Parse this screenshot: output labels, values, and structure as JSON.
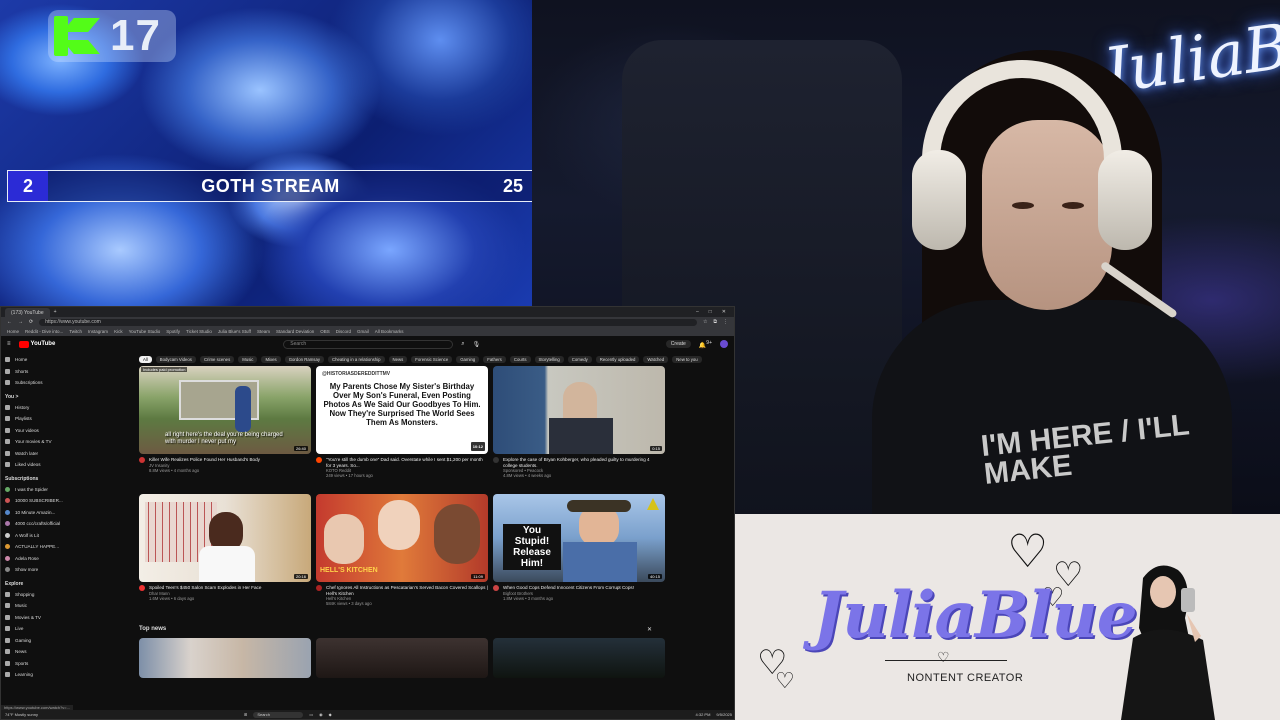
{
  "overlay": {
    "kick_viewers": "17",
    "goth_stream": {
      "left_value": "2",
      "title": "GOTH STREAM",
      "right_value": "25"
    }
  },
  "neon_sign": "JuliaB",
  "hoodie_text": "I'M HERE / I'LL MAKE",
  "brand": {
    "name": "JuliaBlue",
    "subtitle": "NONTENT CREATOR",
    "accent_color": "#7b74e8"
  },
  "browser": {
    "tab_title": "(173) YouTube",
    "url": "https://www.youtube.com",
    "bookmarks": [
      "Home",
      "Reddit - Dive into...",
      "Twitch",
      "Instagram",
      "Kick",
      "YouTube Studio",
      "Spotify",
      "Ticket Studio",
      "Julia Blue's Stuff",
      "Steam",
      "Standard Deviation",
      "OBS",
      "Discord",
      "Gmail",
      "All Bookmarks"
    ],
    "youtube": {
      "logo": "YouTube",
      "search_placeholder": "Search",
      "create_label": "Create",
      "notification_count": "9+",
      "sidebar": {
        "main": [
          {
            "label": "Home",
            "icon": "home-icon"
          },
          {
            "label": "Shorts",
            "icon": "shorts-icon"
          },
          {
            "label": "Subscriptions",
            "icon": "subscriptions-icon"
          }
        ],
        "you_header": "You  >",
        "you": [
          {
            "label": "History",
            "icon": "history-icon"
          },
          {
            "label": "Playlists",
            "icon": "playlist-icon"
          },
          {
            "label": "Your videos",
            "icon": "video-icon"
          },
          {
            "label": "Your movies & TV",
            "icon": "movie-icon"
          },
          {
            "label": "Watch later",
            "icon": "clock-icon"
          },
          {
            "label": "Liked videos",
            "icon": "like-icon"
          }
        ],
        "subscriptions_header": "Subscriptions",
        "subscriptions": [
          {
            "label": "I was the Spider",
            "color": "#6a6"
          },
          {
            "label": "10000 SUBSCRIBER...",
            "color": "#c55"
          },
          {
            "label": "10 Minute Amazin...",
            "color": "#58c"
          },
          {
            "label": "4000 ccc/crafts/official",
            "color": "#a7a"
          },
          {
            "label": "A Wolf is Lit",
            "color": "#ccc"
          },
          {
            "label": "ACTUALLY HAPPE...",
            "color": "#d93"
          },
          {
            "label": "Adela Rose",
            "color": "#c8a"
          },
          {
            "label": "Show more",
            "color": "#888"
          }
        ],
        "explore_header": "Explore",
        "explore": [
          {
            "label": "Shopping",
            "icon": "bag-icon"
          },
          {
            "label": "Music",
            "icon": "music-icon"
          },
          {
            "label": "Movies & TV",
            "icon": "movie-icon"
          },
          {
            "label": "Live",
            "icon": "live-icon"
          },
          {
            "label": "Gaming",
            "icon": "gaming-icon"
          },
          {
            "label": "News",
            "icon": "news-icon"
          },
          {
            "label": "Sports",
            "icon": "trophy-icon"
          },
          {
            "label": "Learning",
            "icon": "bulb-icon"
          }
        ]
      },
      "chips": [
        "All",
        "Bodycam Videos",
        "Crime scenes",
        "Music",
        "Mixes",
        "Gordon Ramsay",
        "Cheating in a relationship",
        "News",
        "Forensic Science",
        "Gaming",
        "Fathers",
        "Courts",
        "Storytelling",
        "Comedy",
        "Recently uploaded",
        "Watched",
        "New to you"
      ],
      "row1": [
        {
          "title": "Killer Wife Realizes Police Found Her Husband's Body",
          "channel": "JV Insanity",
          "stats": "8.8M views • 4 months ago",
          "duration": "26:40",
          "caption": "all right here's the deal you're being charged with murder I never put my",
          "top_label": "Includes paid promotion"
        },
        {
          "title": "\"You're still the dumb one\" Dad said. Overstate while I sent $1,200 per month for 3 years. So...",
          "channel": "KOTO Reddit",
          "stats": "249 views • 17 hours ago",
          "duration": "10:12",
          "handle": "@HISTORIASDEREDDITTMV",
          "headline": "My Parents Chose My Sister's Birthday Over My Son's Funeral, Even Posting Photos As We Said Our Goodbyes To Him. Now They're Surprised The World Sees Them As Monsters.",
          "likes": "99+"
        },
        {
          "title": "Explore the case of Bryan Kohberger, who pleaded guilty to murdering 4 college students.",
          "channel": "Sponsored • Peacock",
          "stats": "4.8M views • 4 weeks ago",
          "duration": "0:15"
        }
      ],
      "row2": [
        {
          "title": "Spoiled Teen's $450 Salon Scam Explodes in Her Face",
          "channel": "Dhar Mann",
          "stats": "1.6M views • 6 days ago",
          "duration": "20:16"
        },
        {
          "title": "Chef Ignores All Instructions as Pescatarian's Served Bacon Covered Scallops | Hell's Kitchen",
          "channel": "Hell's Kitchen",
          "stats": "584K views • 3 days ago",
          "duration": "11:09",
          "label": "HELL'S KITCHEN"
        },
        {
          "title": "When Good Cops Defend Innocent Citizens From Corrupt Cops!",
          "channel": "Bigfoot Brothers",
          "stats": "1.8M views • 3 months ago",
          "duration": "40:15",
          "callout": "You Stupid! Release Him!"
        }
      ],
      "top_news": "Top news",
      "close": "✕",
      "status_url": "https://www.youtube.com/watch?v=..."
    },
    "taskbar": {
      "search": "Search",
      "time": "4:32 PM",
      "date": "9/5/2025",
      "weather": "74°F Mostly sunny"
    }
  }
}
